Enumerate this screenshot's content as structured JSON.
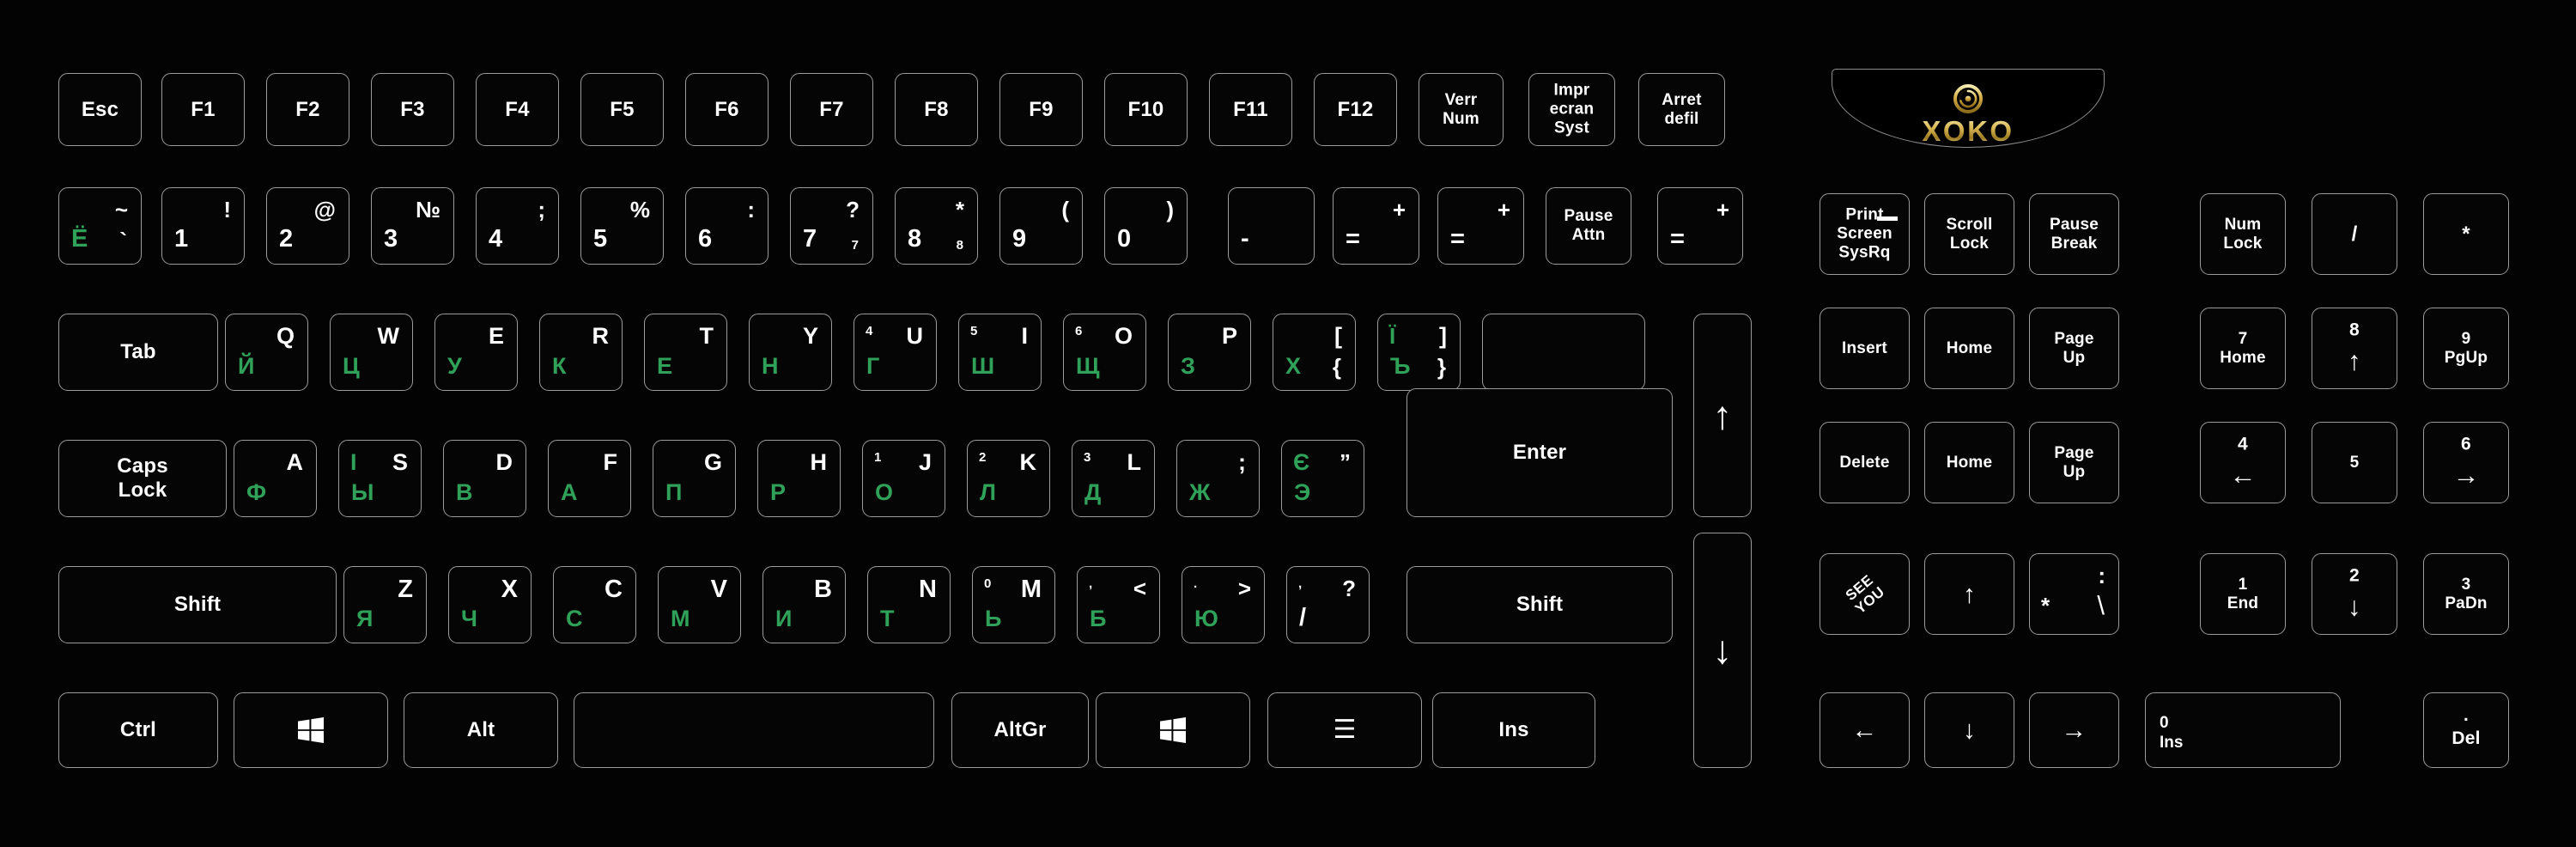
{
  "device": {
    "brand": "XOKO",
    "layout_name": "Ukrainian/Russian bilingual full-size keyboard",
    "colors": {
      "background": "#000000",
      "key_fill": "#050505",
      "key_border": "#9b9b9b",
      "latin_legend": "#ffffff",
      "cyrillic_legend": "#2fa158",
      "brand_gold": "#d8b552"
    }
  },
  "function_row": [
    {
      "name": "esc",
      "label": "Esc"
    },
    {
      "name": "f1",
      "label": "F1"
    },
    {
      "name": "f2",
      "label": "F2"
    },
    {
      "name": "f3",
      "label": "F3"
    },
    {
      "name": "f4",
      "label": "F4"
    },
    {
      "name": "f5",
      "label": "F5"
    },
    {
      "name": "f6",
      "label": "F6"
    },
    {
      "name": "f7",
      "label": "F7"
    },
    {
      "name": "f8",
      "label": "F8"
    },
    {
      "name": "f9",
      "label": "F9"
    },
    {
      "name": "f10",
      "label": "F10"
    },
    {
      "name": "f11",
      "label": "F11"
    },
    {
      "name": "f12",
      "label": "F12"
    },
    {
      "name": "verr-num",
      "label": "Verr\nNum"
    },
    {
      "name": "impr-ecran-syst",
      "label": "Impr\necran\nSyst"
    },
    {
      "name": "arret-defil",
      "label": "Arret\ndefil"
    }
  ],
  "number_row": [
    {
      "name": "backquote",
      "tr": "~",
      "br": "`",
      "bl": "Ё"
    },
    {
      "name": "digit-1",
      "tr": "!",
      "bl": "1"
    },
    {
      "name": "digit-2",
      "tr": "@",
      "bl": "2"
    },
    {
      "name": "digit-3",
      "tr": "№",
      "bl": "3"
    },
    {
      "name": "digit-4",
      "tr": ";",
      "bl": "4"
    },
    {
      "name": "digit-5",
      "tr": "%",
      "bl": "5"
    },
    {
      "name": "digit-6",
      "tr": ":",
      "bl": "6"
    },
    {
      "name": "digit-7",
      "tr": "?",
      "bl": "7",
      "br": "7"
    },
    {
      "name": "digit-8",
      "tr": "*",
      "bl": "8",
      "br": "8"
    },
    {
      "name": "digit-9",
      "tr": "(",
      "bl": "9"
    },
    {
      "name": "digit-0",
      "tr": ")",
      "bl": "0"
    },
    {
      "name": "minus",
      "bl": "-"
    },
    {
      "name": "equal",
      "tr": "+",
      "bl": "="
    },
    {
      "name": "equal-dup",
      "tr": "+",
      "bl": "="
    },
    {
      "name": "pause-attn",
      "label": "Pause\nAttn"
    },
    {
      "name": "equal-dup2",
      "tr": "+",
      "bl": "="
    }
  ],
  "qwerty_row": [
    {
      "name": "tab",
      "label": "Tab"
    },
    {
      "name": "key-q",
      "tr": "Q",
      "bl": "Й"
    },
    {
      "name": "key-w",
      "tr": "W",
      "bl": "Ц"
    },
    {
      "name": "key-e",
      "tr": "E",
      "bl": "У"
    },
    {
      "name": "key-r",
      "tr": "R",
      "bl": "К"
    },
    {
      "name": "key-t",
      "tr": "T",
      "bl": "Е"
    },
    {
      "name": "key-y",
      "tr": "Y",
      "bl": "Н"
    },
    {
      "name": "key-u",
      "tr": "U",
      "tl": "4",
      "bl": "Г"
    },
    {
      "name": "key-i",
      "tr": "I",
      "tl": "5",
      "bl": "Ш"
    },
    {
      "name": "key-o",
      "tr": "O",
      "tl": "6",
      "bl": "Щ"
    },
    {
      "name": "key-p",
      "tr": "P",
      "bl": "З"
    },
    {
      "name": "bracket-left",
      "tr": "[",
      "br": "{",
      "bl": "Х"
    },
    {
      "name": "bracket-right",
      "tr": "]",
      "br": "}",
      "tl": "Ї",
      "bl": "Ъ"
    },
    {
      "name": "backslash-blank",
      "label": ""
    }
  ],
  "home_row": [
    {
      "name": "caps-lock",
      "label": "Caps\nLock"
    },
    {
      "name": "key-a",
      "tr": "A",
      "bl": "Ф"
    },
    {
      "name": "key-s",
      "tr": "S",
      "tl": "І",
      "bl": "Ы"
    },
    {
      "name": "key-d",
      "tr": "D",
      "bl": "В"
    },
    {
      "name": "key-f",
      "tr": "F",
      "bl": "А"
    },
    {
      "name": "key-g",
      "tr": "G",
      "bl": "П"
    },
    {
      "name": "key-h",
      "tr": "H",
      "bl": "Р"
    },
    {
      "name": "key-j",
      "tr": "J",
      "tl": "1",
      "bl": "О"
    },
    {
      "name": "key-k",
      "tr": "K",
      "tl": "2",
      "bl": "Л"
    },
    {
      "name": "key-l",
      "tr": "L",
      "tl": "3",
      "bl": "Д"
    },
    {
      "name": "semicolon",
      "tr": ";",
      "bl": "Ж"
    },
    {
      "name": "quote",
      "tr": "”",
      "tl": "Є",
      "bl": "Э"
    },
    {
      "name": "enter",
      "label": "Enter"
    }
  ],
  "shift_row": [
    {
      "name": "shift-left",
      "label": "Shift"
    },
    {
      "name": "key-z",
      "tr": "Z",
      "bl": "Я"
    },
    {
      "name": "key-x",
      "tr": "X",
      "bl": "Ч"
    },
    {
      "name": "key-c",
      "tr": "C",
      "bl": "С"
    },
    {
      "name": "key-v",
      "tr": "V",
      "bl": "М"
    },
    {
      "name": "key-b",
      "tr": "B",
      "bl": "И"
    },
    {
      "name": "key-n",
      "tr": "N",
      "bl": "Т"
    },
    {
      "name": "key-m",
      "tr": "M",
      "tl": "0",
      "bl": "Ь"
    },
    {
      "name": "comma",
      "tr": "<",
      "tl": ",",
      "bl": "Б"
    },
    {
      "name": "period",
      "tr": ">",
      "tl": ".",
      "bl": "Ю"
    },
    {
      "name": "slash",
      "tr": "?",
      "tl": ",",
      "bl": "/"
    },
    {
      "name": "shift-right",
      "label": "Shift"
    }
  ],
  "bottom_row": [
    {
      "name": "ctrl-left",
      "label": "Ctrl"
    },
    {
      "name": "win-left",
      "icon": "windows-icon"
    },
    {
      "name": "alt-left",
      "label": "Alt"
    },
    {
      "name": "space",
      "label": ""
    },
    {
      "name": "altgr",
      "label": "AltGr"
    },
    {
      "name": "win-right",
      "icon": "windows-icon"
    },
    {
      "name": "menu",
      "icon": "menu-icon"
    },
    {
      "name": "ins",
      "label": "Ins"
    }
  ],
  "tall_arrows": [
    {
      "name": "arrow-up-tall",
      "glyph": "↑"
    },
    {
      "name": "arrow-down-tall",
      "glyph": "↓"
    }
  ],
  "nav_cluster": [
    {
      "name": "print-screen-sysrq",
      "label": "Print\nScreen\nSysRq",
      "has_strike": true
    },
    {
      "name": "scroll-lock",
      "label": "Scroll\nLock"
    },
    {
      "name": "pause-break",
      "label": "Pause\nBreak"
    },
    {
      "name": "insert",
      "label": "Insert"
    },
    {
      "name": "home-1",
      "label": "Home"
    },
    {
      "name": "page-up-1",
      "label": "Page\nUp"
    },
    {
      "name": "delete",
      "label": "Delete"
    },
    {
      "name": "home-2",
      "label": "Home"
    },
    {
      "name": "page-up-2",
      "label": "Page\nUp"
    },
    {
      "name": "see-you",
      "label": "SEE\nYOU",
      "rotated": true
    },
    {
      "name": "arrow-up",
      "glyph": "↑"
    },
    {
      "name": "colon-backslash",
      "tr": ":",
      "tl": "*",
      "br": "\\"
    },
    {
      "name": "arrow-left",
      "glyph": "←"
    },
    {
      "name": "arrow-down",
      "glyph": "↓"
    },
    {
      "name": "arrow-right",
      "glyph": "→"
    }
  ],
  "numpad": [
    {
      "name": "num-lock",
      "label": "Num\nLock"
    },
    {
      "name": "numpad-divide",
      "label": "/"
    },
    {
      "name": "numpad-multiply",
      "label": "*"
    },
    {
      "name": "numpad-7-home",
      "label": "7\nHome"
    },
    {
      "name": "numpad-8-up",
      "label": "8",
      "glyph": "↑"
    },
    {
      "name": "numpad-9-pgup",
      "label": "9\nPgUp"
    },
    {
      "name": "numpad-4-left",
      "label": "4",
      "glyph": "←"
    },
    {
      "name": "numpad-5",
      "label": "5"
    },
    {
      "name": "numpad-6-right",
      "label": "6",
      "glyph": "→"
    },
    {
      "name": "numpad-1-end",
      "label": "1\nEnd"
    },
    {
      "name": "numpad-2-down",
      "label": "2",
      "glyph": "↓"
    },
    {
      "name": "numpad-3-padn",
      "label": "3\nPaDn"
    },
    {
      "name": "numpad-0-ins",
      "label": "0\nIns"
    },
    {
      "name": "numpad-del",
      "label": "Del",
      "dot": "."
    }
  ]
}
